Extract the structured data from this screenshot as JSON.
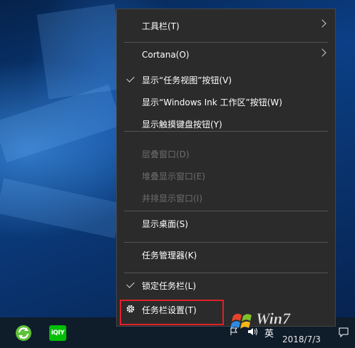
{
  "menu": {
    "items": [
      {
        "label": "工具栏(T)",
        "submenu": true,
        "checked": false,
        "enabled": true
      },
      {
        "label": "Cortana(O)",
        "submenu": true,
        "checked": false,
        "enabled": true
      },
      {
        "label": "显示“任务视图”按钮(V)",
        "submenu": false,
        "checked": true,
        "enabled": true
      },
      {
        "label": "显示“Windows Ink 工作区”按钮(W)",
        "submenu": false,
        "checked": false,
        "enabled": true
      },
      {
        "label": "显示触摸键盘按钮(Y)",
        "submenu": false,
        "checked": false,
        "enabled": true
      },
      {
        "label": "层叠窗口(D)",
        "submenu": false,
        "checked": false,
        "enabled": false
      },
      {
        "label": "堆叠显示窗口(E)",
        "submenu": false,
        "checked": false,
        "enabled": false
      },
      {
        "label": "并排显示窗口(I)",
        "submenu": false,
        "checked": false,
        "enabled": false
      },
      {
        "label": "显示桌面(S)",
        "submenu": false,
        "checked": false,
        "enabled": true
      },
      {
        "label": "任务管理器(K)",
        "submenu": false,
        "checked": false,
        "enabled": true
      },
      {
        "label": "锁定任务栏(L)",
        "submenu": false,
        "checked": true,
        "enabled": true
      },
      {
        "label": "任务栏设置(T)",
        "submenu": false,
        "checked": false,
        "enabled": true,
        "icon": "gear-icon",
        "highlighted": true
      }
    ]
  },
  "taskbar": {
    "apps": [
      {
        "name": "green-refresh-app-icon"
      },
      {
        "name": "iqiyi-app-icon",
        "text": "iQIY"
      }
    ],
    "tray": {
      "ime": "英",
      "date": "2018/7/3",
      "watermark_text": "Win7"
    }
  },
  "colors": {
    "menu_bg": "#2b2b2b",
    "highlight_border": "#e0202a",
    "disabled_text": "#6d6d6d",
    "iqiyi_green": "#00be06"
  }
}
